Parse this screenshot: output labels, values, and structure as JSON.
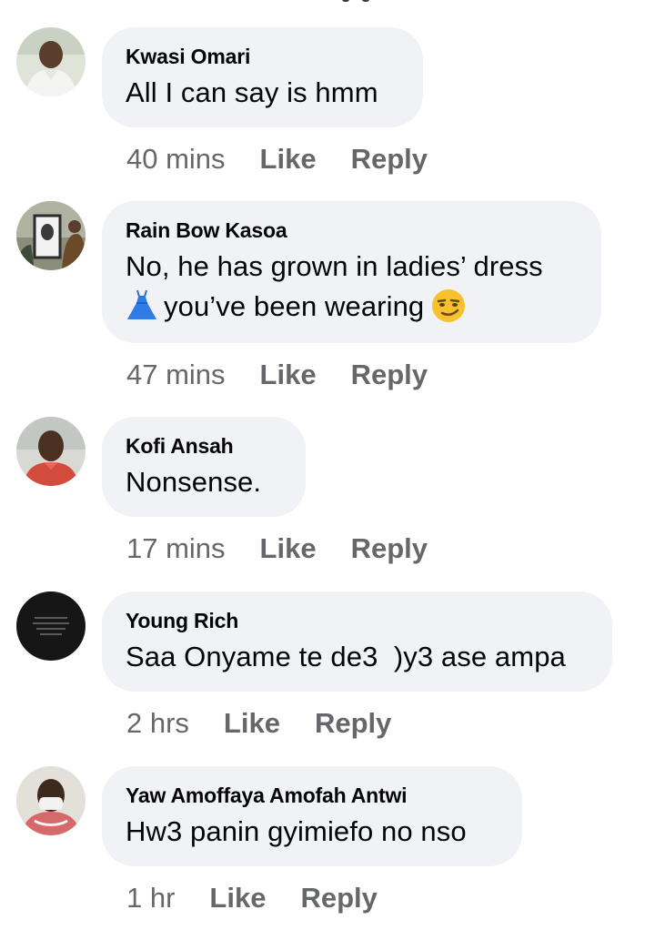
{
  "comments": [
    {
      "author": "Kwasi Omari",
      "text": "All I can say is hmm",
      "time": "40 mins",
      "like_label": "Like",
      "reply_label": "Reply"
    },
    {
      "author": "Rain Bow Kasoa",
      "text_line1": "No, he has grown in ladies’ dress",
      "text_line2": "you’ve been wearing",
      "emoji_1": "dress-emoji",
      "emoji_2": "smirking-face-emoji",
      "time": "47 mins",
      "like_label": "Like",
      "reply_label": "Reply"
    },
    {
      "author": "Kofi Ansah",
      "text": "Nonsense.",
      "time": "17 mins",
      "like_label": "Like",
      "reply_label": "Reply"
    },
    {
      "author": "Young Rich",
      "text": "Saa Onyame te de3  )y3 ase ampa",
      "time": "2 hrs",
      "like_label": "Like",
      "reply_label": "Reply"
    },
    {
      "author": "Yaw Amoffaya Amofah Antwi",
      "text": "Hw3 panin gyimiefo no nso",
      "time": "1 hr",
      "like_label": "Like",
      "reply_label": "Reply"
    }
  ],
  "colors": {
    "bubble_bg": "#f0f2f5",
    "meta_text": "#65676b",
    "body_text": "#050505"
  }
}
